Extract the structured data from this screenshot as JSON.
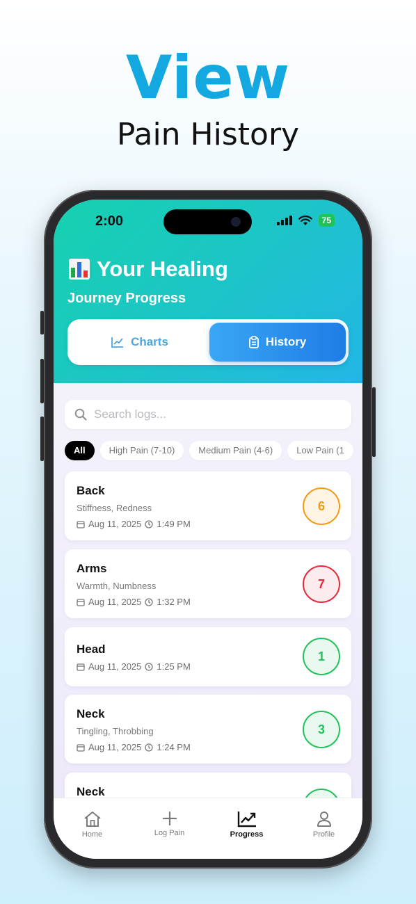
{
  "promo": {
    "title": "View",
    "subtitle": "Pain History"
  },
  "status_bar": {
    "time": "2:00",
    "battery": "75"
  },
  "header": {
    "title": "Your Healing",
    "subtitle": "Journey Progress",
    "tabs": [
      {
        "label": "Charts",
        "icon": "line-chart-icon",
        "active": false
      },
      {
        "label": "History",
        "icon": "clipboard-icon",
        "active": true
      }
    ]
  },
  "search": {
    "placeholder": "Search logs..."
  },
  "filters": [
    "All",
    "High Pain (7-10)",
    "Medium Pain (4-6)",
    "Low Pain (1"
  ],
  "logs": [
    {
      "area": "Back",
      "symptoms": "Stiffness, Redness",
      "date": "Aug 11, 2025",
      "time": "1:49 PM",
      "score": "6",
      "color": "#f39a14"
    },
    {
      "area": "Arms",
      "symptoms": "Warmth, Numbness",
      "date": "Aug 11, 2025",
      "time": "1:32 PM",
      "score": "7",
      "color": "#e5283c"
    },
    {
      "area": "Head",
      "symptoms": "",
      "date": "Aug 11, 2025",
      "time": "1:25 PM",
      "score": "1",
      "color": "#1fc35a"
    },
    {
      "area": "Neck",
      "symptoms": "Tingling, Throbbing",
      "date": "Aug 11, 2025",
      "time": "1:24 PM",
      "score": "3",
      "color": "#1fc35a"
    },
    {
      "area": "Neck",
      "symptoms": "",
      "date": "",
      "time": "",
      "score": "",
      "color": "#1fc35a"
    }
  ],
  "tabbar": [
    {
      "label": "Home",
      "icon": "home-icon",
      "active": false
    },
    {
      "label": "Log Pain",
      "icon": "plus-icon",
      "active": false
    },
    {
      "label": "Progress",
      "icon": "trend-chart-icon",
      "active": true
    },
    {
      "label": "Profile",
      "icon": "person-icon",
      "active": false
    }
  ]
}
